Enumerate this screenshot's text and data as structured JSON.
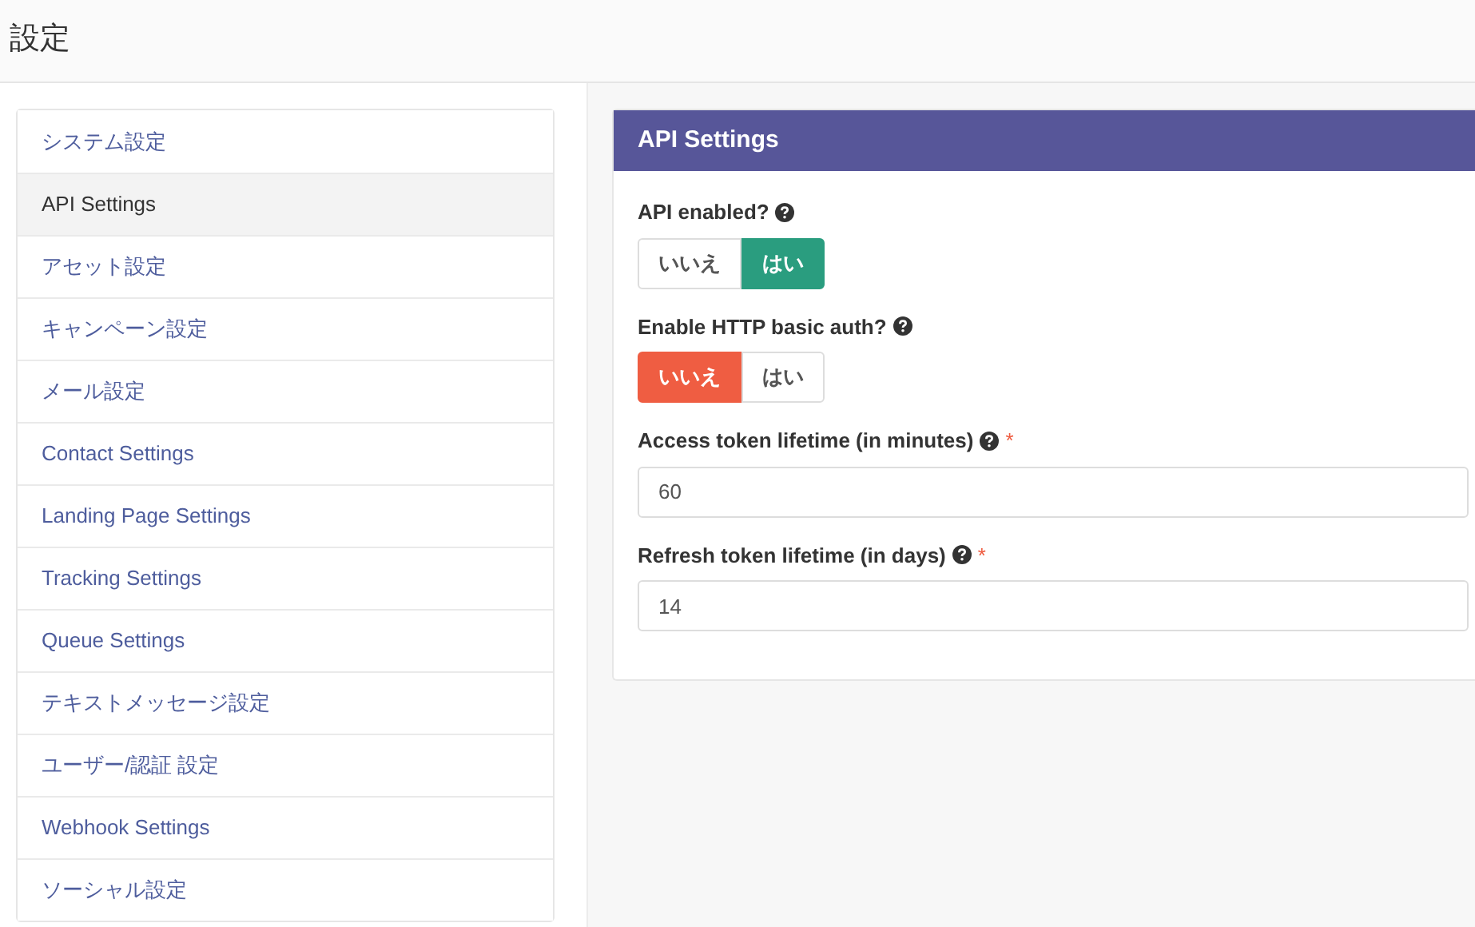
{
  "page_title": "設定",
  "sidebar": {
    "items": [
      {
        "label": "システム設定",
        "selected": false
      },
      {
        "label": "API Settings",
        "selected": true
      },
      {
        "label": "アセット設定",
        "selected": false
      },
      {
        "label": "キャンペーン設定",
        "selected": false
      },
      {
        "label": "メール設定",
        "selected": false
      },
      {
        "label": "Contact Settings",
        "selected": false
      },
      {
        "label": "Landing Page Settings",
        "selected": false
      },
      {
        "label": "Tracking Settings",
        "selected": false
      },
      {
        "label": "Queue Settings",
        "selected": false
      },
      {
        "label": "テキストメッセージ設定",
        "selected": false
      },
      {
        "label": "ユーザー/認証 設定",
        "selected": false
      },
      {
        "label": "Webhook Settings",
        "selected": false
      },
      {
        "label": "ソーシャル設定",
        "selected": false
      }
    ]
  },
  "panel": {
    "title": "API Settings",
    "fields": [
      {
        "kind": "toggle",
        "label": "API enabled?",
        "options": [
          {
            "label": "いいえ",
            "kind": "no",
            "selected": false
          },
          {
            "label": "はい",
            "kind": "yes",
            "selected": true
          }
        ]
      },
      {
        "kind": "toggle",
        "label": "Enable HTTP basic auth?",
        "options": [
          {
            "label": "いいえ",
            "kind": "no",
            "selected": true
          },
          {
            "label": "はい",
            "kind": "yes",
            "selected": false
          }
        ]
      },
      {
        "kind": "text",
        "label": "Access token lifetime (in minutes)",
        "required_mark": "*",
        "value": "60"
      },
      {
        "kind": "text",
        "label": "Refresh token lifetime (in days)",
        "required_mark": "*",
        "value": "14"
      }
    ]
  }
}
